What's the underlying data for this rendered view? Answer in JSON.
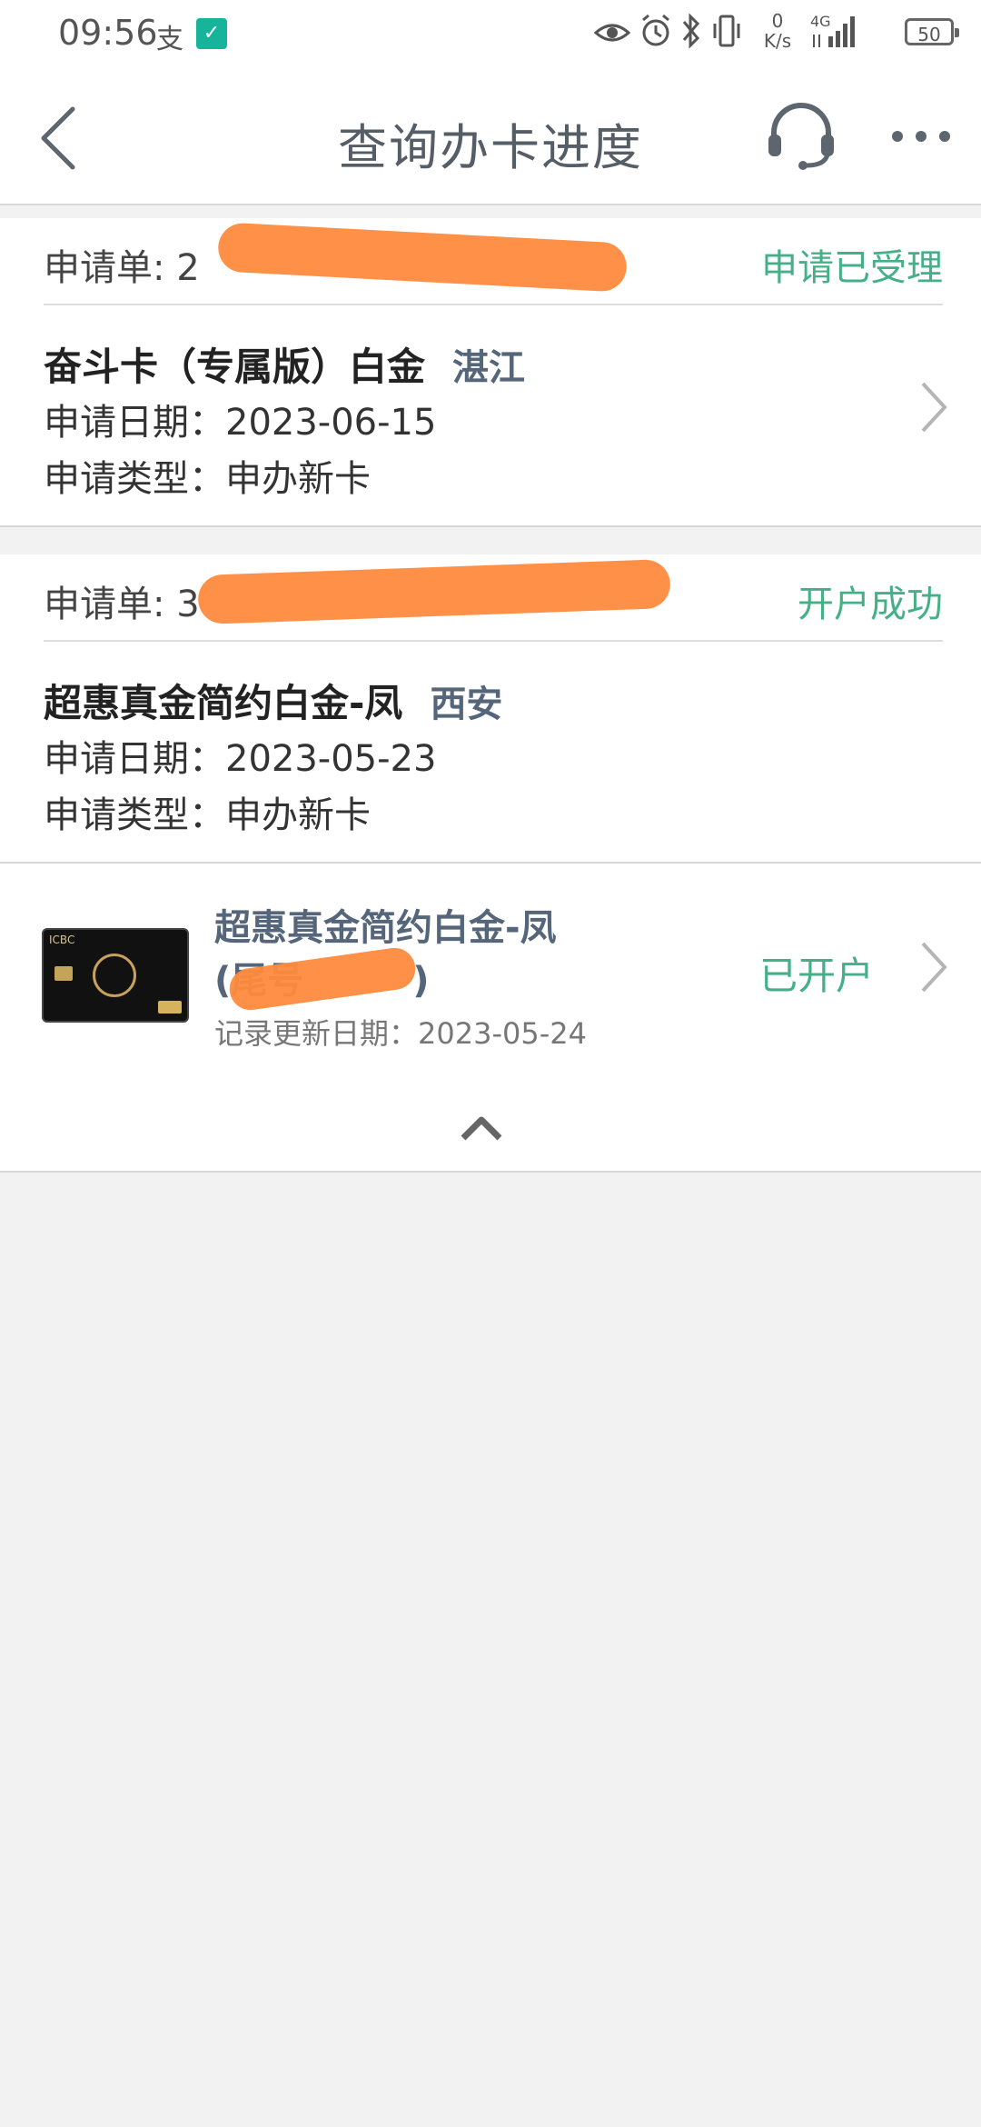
{
  "status_bar": {
    "time": "09:56",
    "alipay_glyph": "支",
    "mi_glyph": "✓",
    "net_speed_top": "0",
    "net_speed_unit": "K/s",
    "network": "4G",
    "battery": "50",
    "icons": [
      "eye-icon",
      "alarm-icon",
      "bluetooth-icon",
      "vibrate-icon",
      "signal-icon"
    ]
  },
  "header": {
    "title": "查询办卡进度",
    "back_icon": "chevron-left-icon",
    "service_icon": "headset-icon",
    "more_icon": "more-dots-icon"
  },
  "applications": [
    {
      "label": "申请单:",
      "number_visible": "2",
      "status": "申请已受理",
      "card_name": "奋斗卡（专属版）白金",
      "city": "湛江",
      "date_line": "申请日期：2023-06-15",
      "type_line": "申请类型：申办新卡"
    },
    {
      "label": "申请单:",
      "number_visible": "3",
      "status": "开户成功",
      "card_name": "超惠真金简约白金-凤",
      "city": "西安",
      "date_line": "申请日期：2023-05-23",
      "type_line": "申请类型：申办新卡"
    }
  ],
  "opened_card": {
    "name": "超惠真金简约白金-凤",
    "tail": "(尾号",
    "tail_end": ")",
    "update_line": "记录更新日期：2023-05-24",
    "status": "已开户",
    "thumb_logo": "ICBC"
  },
  "collapse": {
    "icon": "chevron-up-icon"
  },
  "colors": {
    "accent_green": "#45b088",
    "redaction": "#ff8a3d",
    "title_gray": "#555e66",
    "city_blue_gray": "#55657a"
  }
}
